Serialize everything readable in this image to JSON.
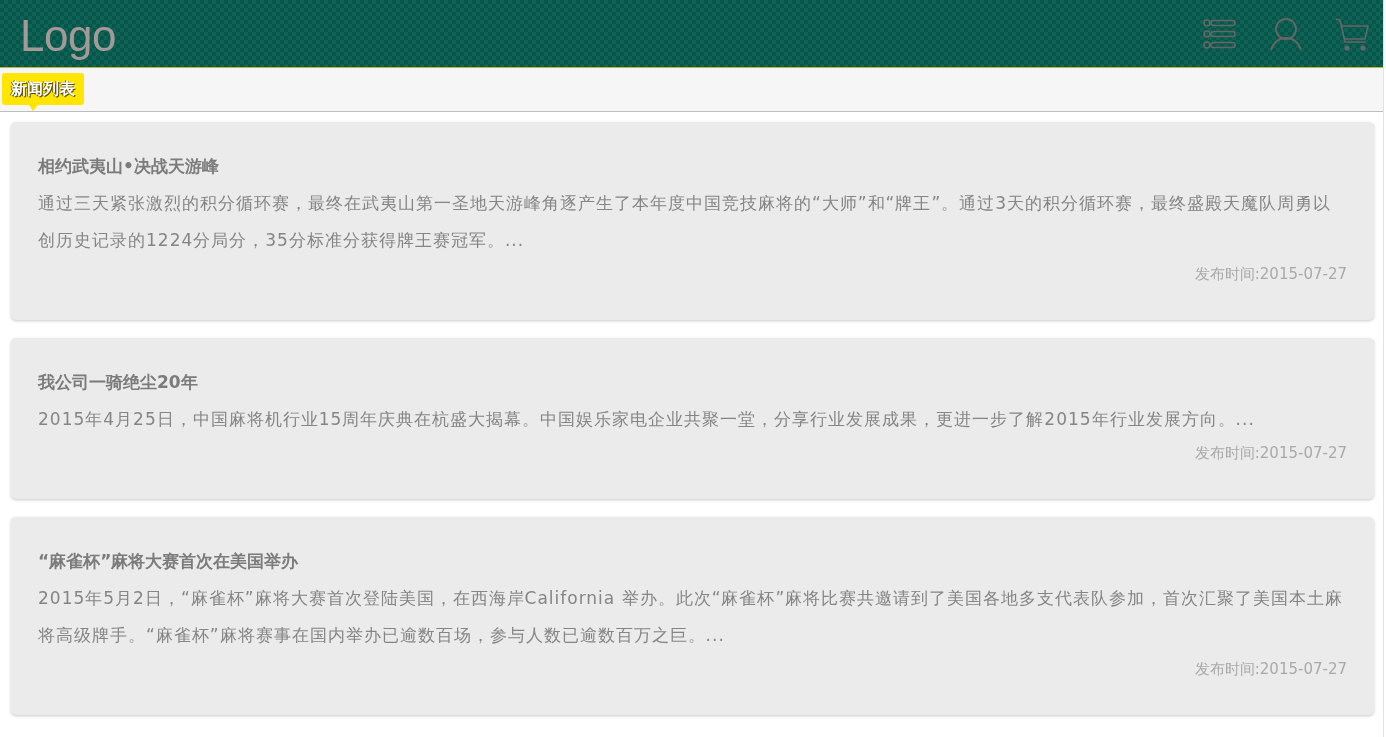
{
  "header": {
    "logo": "Logo"
  },
  "section_label": {
    "text": "新闻列表"
  },
  "news": [
    {
      "title": "相约武夷山•决战天游峰",
      "summary": "通过三天紧张激烈的积分循环赛，最终在武夷山第一圣地天游峰角逐产生了本年度中国竞技麻将的“大师”和“牌王”。通过3天的积分循环赛，最终盛殿天魔队周勇以创历史记录的1224分局分，35分标准分获得牌王赛冠军。...",
      "published": "发布时间:2015-07-27"
    },
    {
      "title": "我公司一骑绝尘20年",
      "summary": "2015年4月25日，中国麻将机行业15周年庆典在杭盛大揭幕。中国娱乐家电企业共聚一堂，分享行业发展成果，更进一步了解2015年行业发展方向。...",
      "published": "发布时间:2015-07-27"
    },
    {
      "title": "“麻雀杯”麻将大赛首次在美国举办",
      "summary": "2015年5月2日，“麻雀杯”麻将大赛首次登陆美国，在西海岸California 举办。此次“麻雀杯”麻将比赛共邀请到了美国各地多支代表队参加，首次汇聚了美国本土麻将高级牌手。“麻雀杯”麻将赛事在国内举办已逾数百场，参与人数已逾数百万之巨。...",
      "published": "发布时间:2015-07-27"
    }
  ]
}
